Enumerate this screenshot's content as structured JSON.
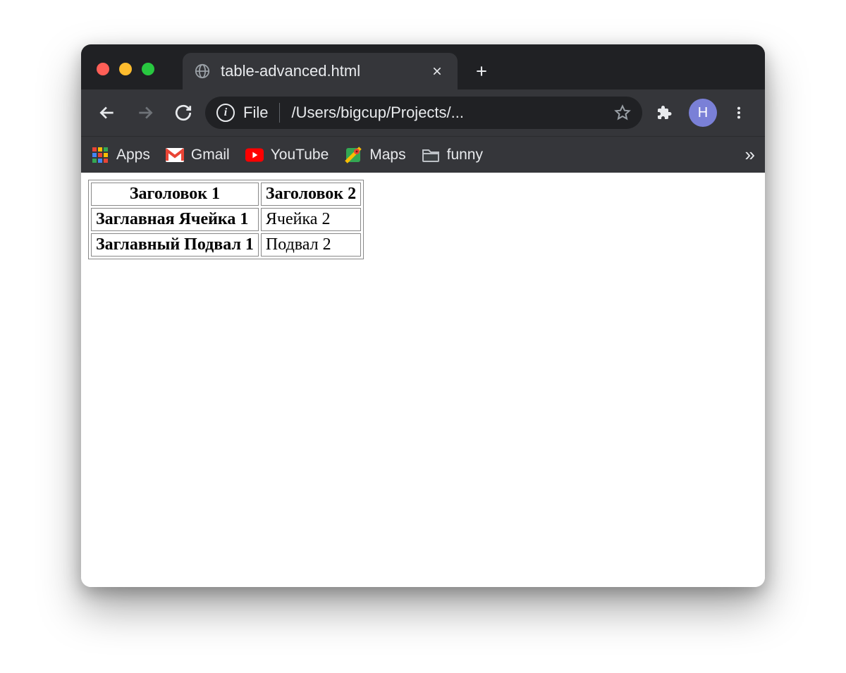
{
  "tab": {
    "title": "table-advanced.html"
  },
  "address": {
    "scheme": "File",
    "path": "/Users/bigcup/Projects/..."
  },
  "profile": {
    "initial": "H"
  },
  "bookmarks": {
    "apps": "Apps",
    "gmail": "Gmail",
    "youtube": "YouTube",
    "maps": "Maps",
    "funny": "funny",
    "overflow": "»"
  },
  "table": {
    "head": [
      "Заголовок 1",
      "Заголовок 2"
    ],
    "row": [
      "Заглавная Ячейка 1",
      "Ячейка 2"
    ],
    "foot": [
      "Заглавный Подвал 1",
      "Подвал 2"
    ]
  }
}
